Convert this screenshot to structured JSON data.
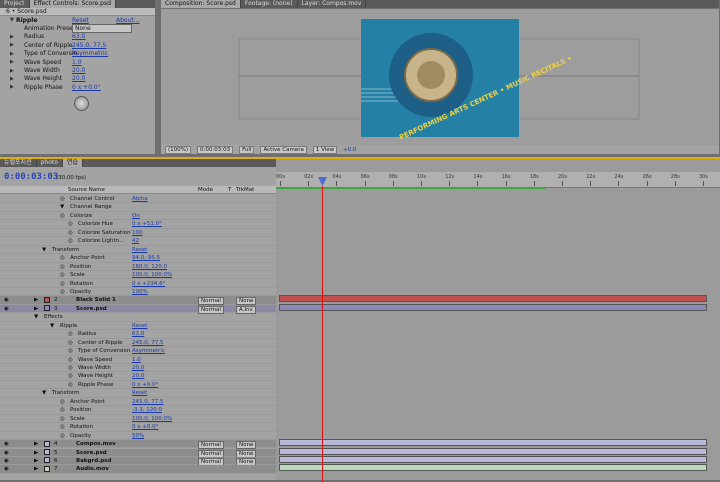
{
  "effect_controls": {
    "tabs": [
      "Project",
      "Effect Controls: Score.psd"
    ],
    "breadcrumb": "6 • Score.psd",
    "effect_name": "Ripple",
    "reset": "Reset",
    "about": "About...",
    "presets_label": "Animation Presets:",
    "presets_value": "None",
    "props": [
      {
        "n": "Radius",
        "v": "63.0"
      },
      {
        "n": "Center of Ripple",
        "v": "245.0, 77.5"
      },
      {
        "n": "Type of Conversio",
        "v": "Asymmetric"
      },
      {
        "n": "Wave Speed",
        "v": "1.0"
      },
      {
        "n": "Wave Width",
        "v": "20.0"
      },
      {
        "n": "Wave Height",
        "v": "20.0"
      },
      {
        "n": "Ripple Phase",
        "v": "0 x +0.0°"
      }
    ]
  },
  "composition": {
    "tabs": [
      "Composition: Score.psd",
      "Footage: (none)",
      "Layer: Compos.mov"
    ],
    "zoom": "(100%)",
    "timecode": "0:00:03:03",
    "resolution": "Full",
    "camera": "Active Camera",
    "views": "1 View",
    "exposure": "+0.0",
    "logo_text": "PERFORMING ARTS CENTER • MUSIC RECITALS •"
  },
  "timeline": {
    "tabs": [
      "뉴렐포지션",
      "photo",
      "연습"
    ],
    "timecode": "0:00:03:03",
    "fps": "(30.00 fps)",
    "headers": {
      "source": "Source Name",
      "mode": "Mode",
      "t": "T",
      "trkmat": "TrkMat"
    },
    "ruler": [
      "00s",
      "02s",
      "04s",
      "06s",
      "08s",
      "10s",
      "12s",
      "14s",
      "16s",
      "18s",
      "20s",
      "22s",
      "24s",
      "26s",
      "28s",
      "30s"
    ],
    "rows": [
      {
        "label": "Channel Control",
        "value": "Alpha",
        "indent": 70
      },
      {
        "label": "Channel Range",
        "value": "",
        "indent": 70
      },
      {
        "label": "Colorize",
        "value": "On",
        "indent": 70
      },
      {
        "label": "Colorize Hue",
        "value": "0 x +51.0°",
        "indent": 78
      },
      {
        "label": "Colorize Saturation",
        "value": "100",
        "indent": 78
      },
      {
        "label": "Colorize Lightn...",
        "value": "42",
        "indent": 78
      },
      {
        "label": "Transform",
        "value": "Reset",
        "indent": 52
      },
      {
        "label": "Anchor Point",
        "value": "94.0, 95.5",
        "indent": 70
      },
      {
        "label": "Position",
        "value": "160.0, 120.0",
        "indent": 70
      },
      {
        "label": "Scale",
        "value": "100.0, 100.0%",
        "indent": 70
      },
      {
        "label": "Rotation",
        "value": "0 x +234.6°",
        "indent": 70
      },
      {
        "label": "Opacity",
        "value": "100%",
        "indent": 70
      },
      {
        "label": "Black Solid 1",
        "num": "2",
        "layer": true,
        "mode": "Normal",
        "trkmat": "None",
        "color": "#c05050"
      },
      {
        "label": "Score.psd",
        "num": "3",
        "layer": true,
        "sel": true,
        "mode": "Normal",
        "trkmat": "A.Inv",
        "color": "#8a8ab8"
      },
      {
        "label": "Effects",
        "value": "",
        "indent": 44
      },
      {
        "label": "Ripple",
        "value": "Reset",
        "indent": 60
      },
      {
        "label": "Radius",
        "value": "63.0",
        "indent": 78
      },
      {
        "label": "Center of Ripple",
        "value": "245.0, 77.5",
        "indent": 78
      },
      {
        "label": "Type of Conversion",
        "value": "Asymmetric",
        "indent": 78
      },
      {
        "label": "Wave Speed",
        "value": "1.0",
        "indent": 78
      },
      {
        "label": "Wave Width",
        "value": "20.0",
        "indent": 78
      },
      {
        "label": "Wave Height",
        "value": "20.0",
        "indent": 78
      },
      {
        "label": "Ripple Phase",
        "value": "0 x +0.0°",
        "indent": 78
      },
      {
        "label": "Transform",
        "value": "Reset",
        "indent": 52
      },
      {
        "label": "Anchor Point",
        "value": "245.0, 77.5",
        "indent": 70
      },
      {
        "label": "Position",
        "value": "-3.3, 120.0",
        "indent": 70
      },
      {
        "label": "Scale",
        "value": "100.0, 100.0%",
        "indent": 70
      },
      {
        "label": "Rotation",
        "value": "0 x +0.0°",
        "indent": 70
      },
      {
        "label": "Opacity",
        "value": "50%",
        "indent": 70
      },
      {
        "label": "Compos.mov",
        "num": "4",
        "layer": true,
        "mode": "Normal",
        "trkmat": "None",
        "color": "#b8b8d8"
      },
      {
        "label": "Score.psd",
        "num": "5",
        "layer": true,
        "mode": "Normal",
        "trkmat": "None",
        "color": "#b8b8d8"
      },
      {
        "label": "Bakgrd.psd",
        "num": "6",
        "layer": true,
        "mode": "Normal",
        "trkmat": "None",
        "color": "#b8b8d8"
      },
      {
        "label": "Audio.mov",
        "num": "7",
        "layer": true,
        "mode": "",
        "trkmat": "",
        "color": "#b8d8b8"
      }
    ]
  }
}
